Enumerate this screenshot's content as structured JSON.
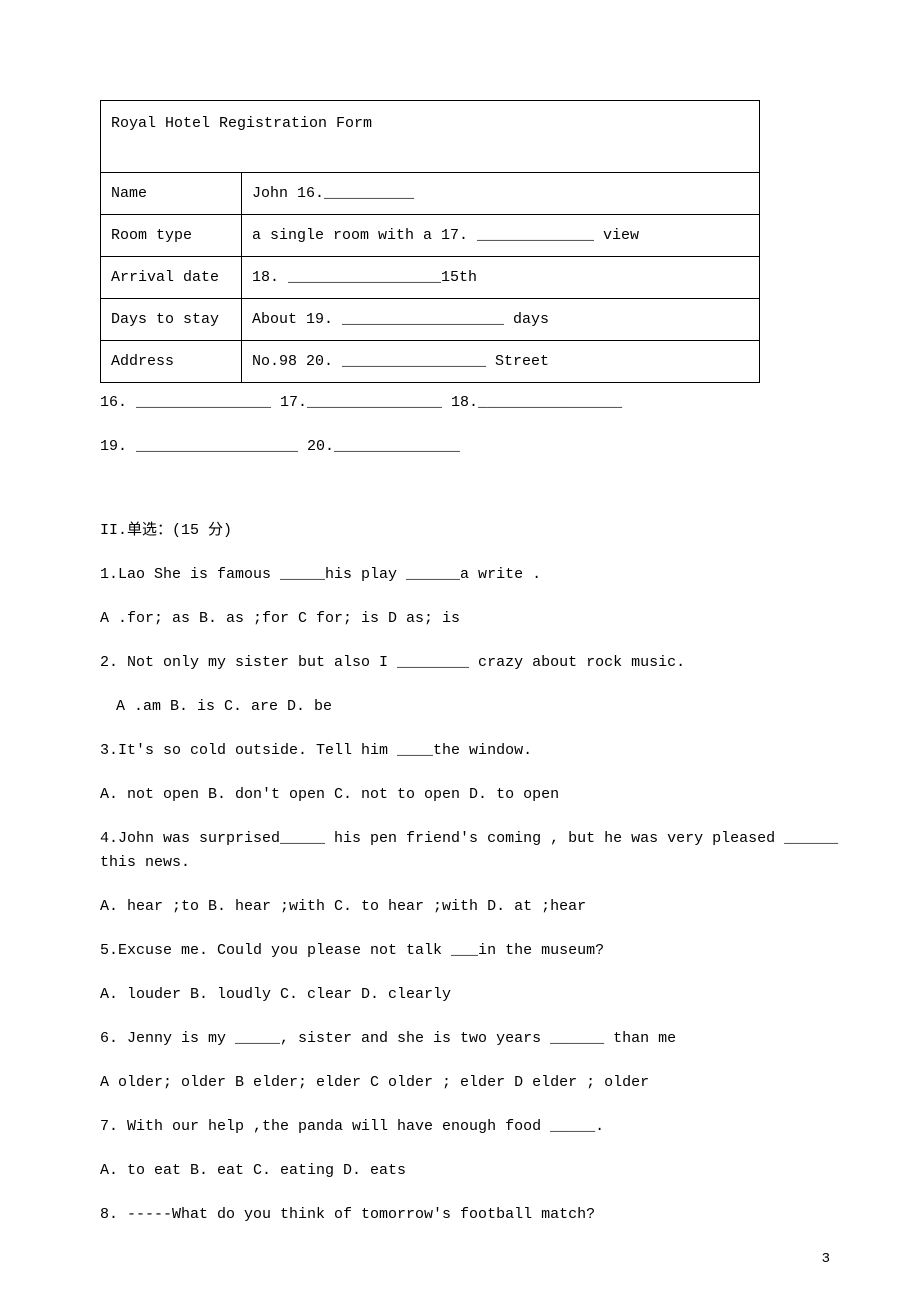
{
  "table": {
    "header": "Royal Hotel Registration Form",
    "rows": [
      {
        "label": "Name",
        "value": "John 16.__________"
      },
      {
        "label": "Room type",
        "value": "a single room with a 17. _____________    view"
      },
      {
        "label": "Arrival date",
        "value": "18. _________________15th"
      },
      {
        "label": "Days to stay",
        "value": "About 19. __________________ days"
      },
      {
        "label": "Address",
        "value": "No.98 20.  ________________ Street"
      }
    ]
  },
  "answers_line1": "16. _______________  17._______________   18.________________",
  "answers_line2": "19. __________________ 20.______________",
  "section2_title": "II.单选：(15 分)",
  "q1": "1.Lao She is famous _____his play ______a write .",
  "q1_opts": "A .for; as    B. as ;for  C for; is   D as; is",
  "q2": "2. Not only my sister but also I ________ crazy about rock music.",
  "q2_opts": "A .am   B. is   C. are   D. be",
  "q3": "3.It's so cold outside. Tell him ____the window.",
  "q3_opts": "A. not open B. don't open C. not to open D. to open",
  "q4": "4.John was surprised_____ his pen friend's coming , but he was very pleased ______ this news.",
  "q4_opts": "A. hear ;to  B. hear ;with C. to hear ;with D. at ;hear",
  "q5": "5.Excuse me. Could you please not talk ___in the museum?",
  "q5_opts": "A. louder  B. loudly C. clear D. clearly",
  "q6": "6.  Jenny is my _____, sister and she is two years ______ than me",
  "q6_opts": "A older; older   B elder; elder  C older ; elder  D elder ; older",
  "q7": "7. With our help ,the panda will have enough food _____.",
  "q7_opts": "A. to eat    B. eat   C. eating   D. eats",
  "q8": "8.  -----What do you think of tomorrow's football match?",
  "page_number": "3"
}
